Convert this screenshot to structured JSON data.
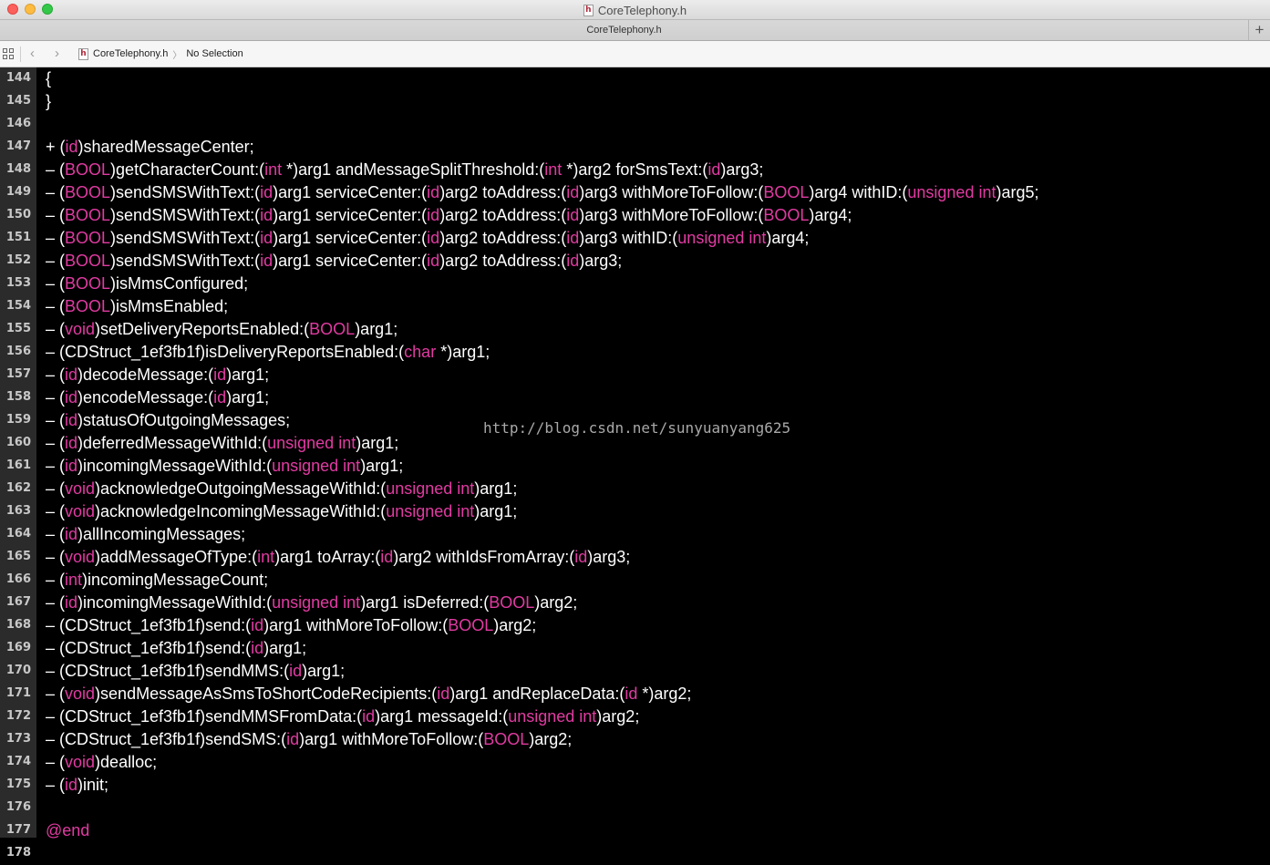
{
  "window": {
    "title": "CoreTelephony.h",
    "file_icon_glyph": "h"
  },
  "tabbar": {
    "tab_label": "CoreTelephony.h",
    "add_glyph": "+"
  },
  "jumpbar": {
    "back_glyph": "‹",
    "forward_glyph": "›",
    "file": "CoreTelephony.h",
    "chevron": "〉",
    "selection": "No Selection"
  },
  "colors": {
    "keyword": "#e13ba2",
    "text": "#ffffff",
    "background": "#000000",
    "gutter": "#2b2b2b"
  },
  "editor": {
    "watermark": "http://blog.csdn.net/sunyuanyang625",
    "lines": [
      {
        "n": "144",
        "tokens": [
          {
            "t": "{"
          }
        ]
      },
      {
        "n": "145",
        "tokens": [
          {
            "t": "}"
          }
        ]
      },
      {
        "n": "146",
        "tokens": []
      },
      {
        "n": "147",
        "tokens": [
          {
            "t": "+ ("
          },
          {
            "t": "id",
            "k": 1
          },
          {
            "t": ")sharedMessageCenter;"
          }
        ]
      },
      {
        "n": "148",
        "tokens": [
          {
            "t": "– ("
          },
          {
            "t": "BOOL",
            "k": 1
          },
          {
            "t": ")getCharacterCount:("
          },
          {
            "t": "int",
            "k": 1
          },
          {
            "t": " *)arg1 andMessageSplitThreshold:("
          },
          {
            "t": "int",
            "k": 1
          },
          {
            "t": " *)arg2 forSmsText:("
          },
          {
            "t": "id",
            "k": 1
          },
          {
            "t": ")arg3;"
          }
        ]
      },
      {
        "n": "149",
        "tokens": [
          {
            "t": "– ("
          },
          {
            "t": "BOOL",
            "k": 1
          },
          {
            "t": ")sendSMSWithText:("
          },
          {
            "t": "id",
            "k": 1
          },
          {
            "t": ")arg1 serviceCenter:("
          },
          {
            "t": "id",
            "k": 1
          },
          {
            "t": ")arg2 toAddress:("
          },
          {
            "t": "id",
            "k": 1
          },
          {
            "t": ")arg3 withMoreToFollow:("
          },
          {
            "t": "BOOL",
            "k": 1
          },
          {
            "t": ")arg4 withID:("
          },
          {
            "t": "unsigned int",
            "k": 1
          },
          {
            "t": ")arg5;"
          }
        ]
      },
      {
        "n": "150",
        "tokens": [
          {
            "t": "– ("
          },
          {
            "t": "BOOL",
            "k": 1
          },
          {
            "t": ")sendSMSWithText:("
          },
          {
            "t": "id",
            "k": 1
          },
          {
            "t": ")arg1 serviceCenter:("
          },
          {
            "t": "id",
            "k": 1
          },
          {
            "t": ")arg2 toAddress:("
          },
          {
            "t": "id",
            "k": 1
          },
          {
            "t": ")arg3 withMoreToFollow:("
          },
          {
            "t": "BOOL",
            "k": 1
          },
          {
            "t": ")arg4;"
          }
        ]
      },
      {
        "n": "151",
        "tokens": [
          {
            "t": "– ("
          },
          {
            "t": "BOOL",
            "k": 1
          },
          {
            "t": ")sendSMSWithText:("
          },
          {
            "t": "id",
            "k": 1
          },
          {
            "t": ")arg1 serviceCenter:("
          },
          {
            "t": "id",
            "k": 1
          },
          {
            "t": ")arg2 toAddress:("
          },
          {
            "t": "id",
            "k": 1
          },
          {
            "t": ")arg3 withID:("
          },
          {
            "t": "unsigned int",
            "k": 1
          },
          {
            "t": ")arg4;"
          }
        ]
      },
      {
        "n": "152",
        "tokens": [
          {
            "t": "– ("
          },
          {
            "t": "BOOL",
            "k": 1
          },
          {
            "t": ")sendSMSWithText:("
          },
          {
            "t": "id",
            "k": 1
          },
          {
            "t": ")arg1 serviceCenter:("
          },
          {
            "t": "id",
            "k": 1
          },
          {
            "t": ")arg2 toAddress:("
          },
          {
            "t": "id",
            "k": 1
          },
          {
            "t": ")arg3;"
          }
        ]
      },
      {
        "n": "153",
        "tokens": [
          {
            "t": "– ("
          },
          {
            "t": "BOOL",
            "k": 1
          },
          {
            "t": ")isMmsConfigured;"
          }
        ]
      },
      {
        "n": "154",
        "tokens": [
          {
            "t": "– ("
          },
          {
            "t": "BOOL",
            "k": 1
          },
          {
            "t": ")isMmsEnabled;"
          }
        ]
      },
      {
        "n": "155",
        "tokens": [
          {
            "t": "– ("
          },
          {
            "t": "void",
            "k": 1
          },
          {
            "t": ")setDeliveryReportsEnabled:("
          },
          {
            "t": "BOOL",
            "k": 1
          },
          {
            "t": ")arg1;"
          }
        ]
      },
      {
        "n": "156",
        "tokens": [
          {
            "t": "– (CDStruct_1ef3fb1f)isDeliveryReportsEnabled:("
          },
          {
            "t": "char",
            "k": 1
          },
          {
            "t": " *)arg1;"
          }
        ]
      },
      {
        "n": "157",
        "tokens": [
          {
            "t": "– ("
          },
          {
            "t": "id",
            "k": 1
          },
          {
            "t": ")decodeMessage:("
          },
          {
            "t": "id",
            "k": 1
          },
          {
            "t": ")arg1;"
          }
        ]
      },
      {
        "n": "158",
        "tokens": [
          {
            "t": "– ("
          },
          {
            "t": "id",
            "k": 1
          },
          {
            "t": ")encodeMessage:("
          },
          {
            "t": "id",
            "k": 1
          },
          {
            "t": ")arg1;"
          }
        ]
      },
      {
        "n": "159",
        "tokens": [
          {
            "t": "– ("
          },
          {
            "t": "id",
            "k": 1
          },
          {
            "t": ")statusOfOutgoingMessages;"
          }
        ]
      },
      {
        "n": "160",
        "tokens": [
          {
            "t": "– ("
          },
          {
            "t": "id",
            "k": 1
          },
          {
            "t": ")deferredMessageWithId:("
          },
          {
            "t": "unsigned int",
            "k": 1
          },
          {
            "t": ")arg1;"
          }
        ]
      },
      {
        "n": "161",
        "tokens": [
          {
            "t": "– ("
          },
          {
            "t": "id",
            "k": 1
          },
          {
            "t": ")incomingMessageWithId:("
          },
          {
            "t": "unsigned int",
            "k": 1
          },
          {
            "t": ")arg1;"
          }
        ]
      },
      {
        "n": "162",
        "tokens": [
          {
            "t": "– ("
          },
          {
            "t": "void",
            "k": 1
          },
          {
            "t": ")acknowledgeOutgoingMessageWithId:("
          },
          {
            "t": "unsigned int",
            "k": 1
          },
          {
            "t": ")arg1;"
          }
        ]
      },
      {
        "n": "163",
        "tokens": [
          {
            "t": "– ("
          },
          {
            "t": "void",
            "k": 1
          },
          {
            "t": ")acknowledgeIncomingMessageWithId:("
          },
          {
            "t": "unsigned int",
            "k": 1
          },
          {
            "t": ")arg1;"
          }
        ]
      },
      {
        "n": "164",
        "tokens": [
          {
            "t": "– ("
          },
          {
            "t": "id",
            "k": 1
          },
          {
            "t": ")allIncomingMessages;"
          }
        ]
      },
      {
        "n": "165",
        "tokens": [
          {
            "t": "– ("
          },
          {
            "t": "void",
            "k": 1
          },
          {
            "t": ")addMessageOfType:("
          },
          {
            "t": "int",
            "k": 1
          },
          {
            "t": ")arg1 toArray:("
          },
          {
            "t": "id",
            "k": 1
          },
          {
            "t": ")arg2 withIdsFromArray:("
          },
          {
            "t": "id",
            "k": 1
          },
          {
            "t": ")arg3;"
          }
        ]
      },
      {
        "n": "166",
        "tokens": [
          {
            "t": "– ("
          },
          {
            "t": "int",
            "k": 1
          },
          {
            "t": ")incomingMessageCount;"
          }
        ]
      },
      {
        "n": "167",
        "tokens": [
          {
            "t": "– ("
          },
          {
            "t": "id",
            "k": 1
          },
          {
            "t": ")incomingMessageWithId:("
          },
          {
            "t": "unsigned int",
            "k": 1
          },
          {
            "t": ")arg1 isDeferred:("
          },
          {
            "t": "BOOL",
            "k": 1
          },
          {
            "t": ")arg2;"
          }
        ]
      },
      {
        "n": "168",
        "tokens": [
          {
            "t": "– (CDStruct_1ef3fb1f)send:("
          },
          {
            "t": "id",
            "k": 1
          },
          {
            "t": ")arg1 withMoreToFollow:("
          },
          {
            "t": "BOOL",
            "k": 1
          },
          {
            "t": ")arg2;"
          }
        ]
      },
      {
        "n": "169",
        "tokens": [
          {
            "t": "– (CDStruct_1ef3fb1f)send:("
          },
          {
            "t": "id",
            "k": 1
          },
          {
            "t": ")arg1;"
          }
        ]
      },
      {
        "n": "170",
        "tokens": [
          {
            "t": "– (CDStruct_1ef3fb1f)sendMMS:("
          },
          {
            "t": "id",
            "k": 1
          },
          {
            "t": ")arg1;"
          }
        ]
      },
      {
        "n": "171",
        "tokens": [
          {
            "t": "– ("
          },
          {
            "t": "void",
            "k": 1
          },
          {
            "t": ")sendMessageAsSmsToShortCodeRecipients:("
          },
          {
            "t": "id",
            "k": 1
          },
          {
            "t": ")arg1 andReplaceData:("
          },
          {
            "t": "id",
            "k": 1
          },
          {
            "t": " *)arg2;"
          }
        ]
      },
      {
        "n": "172",
        "tokens": [
          {
            "t": "– (CDStruct_1ef3fb1f)sendMMSFromData:("
          },
          {
            "t": "id",
            "k": 1
          },
          {
            "t": ")arg1 messageId:("
          },
          {
            "t": "unsigned int",
            "k": 1
          },
          {
            "t": ")arg2;"
          }
        ]
      },
      {
        "n": "173",
        "tokens": [
          {
            "t": "– (CDStruct_1ef3fb1f)sendSMS:("
          },
          {
            "t": "id",
            "k": 1
          },
          {
            "t": ")arg1 withMoreToFollow:("
          },
          {
            "t": "BOOL",
            "k": 1
          },
          {
            "t": ")arg2;"
          }
        ]
      },
      {
        "n": "174",
        "tokens": [
          {
            "t": "– ("
          },
          {
            "t": "void",
            "k": 1
          },
          {
            "t": ")dealloc;"
          }
        ]
      },
      {
        "n": "175",
        "tokens": [
          {
            "t": "– ("
          },
          {
            "t": "id",
            "k": 1
          },
          {
            "t": ")init;"
          }
        ]
      },
      {
        "n": "176",
        "tokens": []
      },
      {
        "n": "177",
        "tokens": [
          {
            "t": "@end",
            "k": 1
          }
        ]
      },
      {
        "n": "178",
        "tokens": []
      }
    ]
  }
}
